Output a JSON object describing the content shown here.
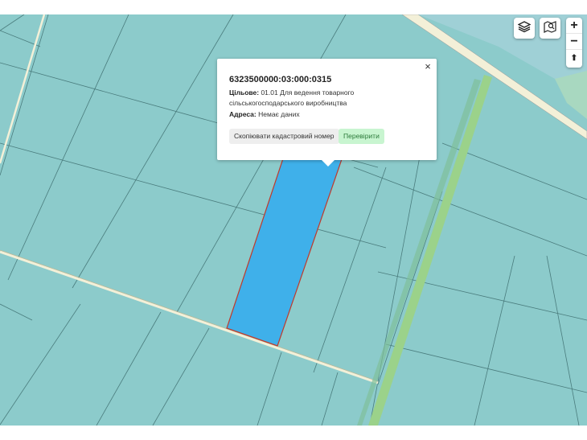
{
  "map": {
    "colors": {
      "parcel_fill": "#8ccbcb",
      "parcel_line": "#3f6f70",
      "selected_fill": "#3fb0ea",
      "selected_border": "#c0392b",
      "road": "#f3f0d8",
      "green_strip": "#9bd28a"
    }
  },
  "controls": {
    "layers_icon": "layers-icon",
    "map_icon": "map-search-icon",
    "zoom_in_label": "+",
    "zoom_out_label": "−",
    "compass_label": "⬆"
  },
  "popup": {
    "close_label": "×",
    "cadastral_number": "6323500000:03:000:0315",
    "purpose_label": "Цільове:",
    "purpose_value": "01.01 Для ведення товарного сільськогосподарського виробництва",
    "address_label": "Адреса:",
    "address_value": "Немає даних",
    "copy_button": "Скопіювати кадастровий номер",
    "check_button": "Перевірити"
  }
}
